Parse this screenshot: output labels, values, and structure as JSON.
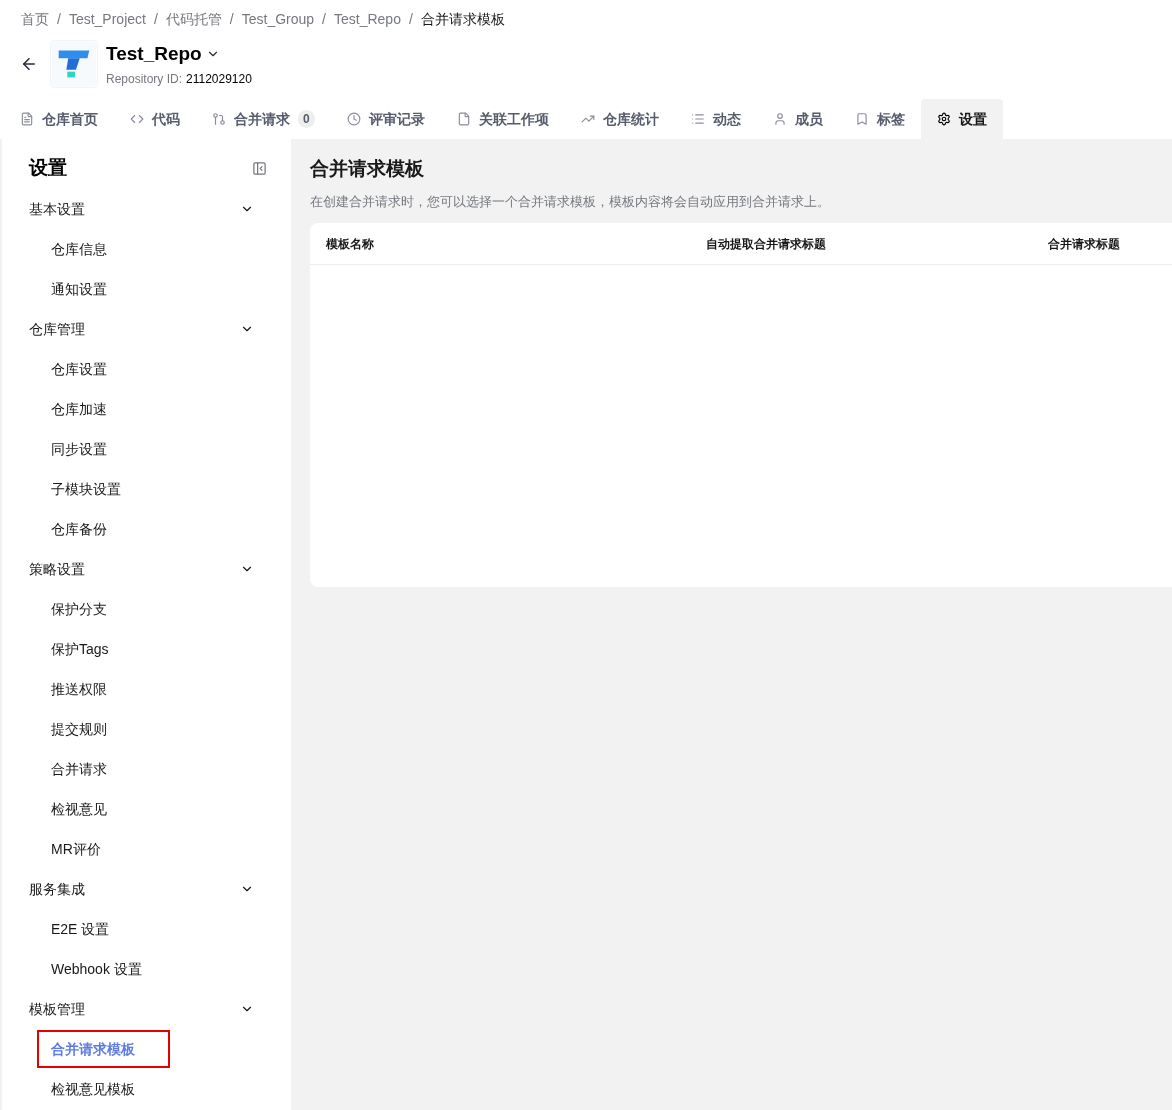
{
  "breadcrumb": [
    "首页",
    "Test_Project",
    "代码托管",
    "Test_Group",
    "Test_Repo",
    "合并请求模板"
  ],
  "breadcrumb_separator": "/",
  "repo": {
    "name": "Test_Repo",
    "id_label": "Repository ID:",
    "id": "2112029120"
  },
  "tabs": [
    {
      "label": "仓库首页",
      "selected": false
    },
    {
      "label": "代码",
      "selected": false
    },
    {
      "label": "合并请求",
      "count": "0",
      "selected": false
    },
    {
      "label": "评审记录",
      "selected": false
    },
    {
      "label": "关联工作项",
      "selected": false
    },
    {
      "label": "仓库统计",
      "selected": false
    },
    {
      "label": "动态",
      "selected": false
    },
    {
      "label": "成员",
      "selected": false
    },
    {
      "label": "标签",
      "selected": false
    },
    {
      "label": "设置",
      "selected": true
    }
  ],
  "sidebar": {
    "title": "设置",
    "groups": [
      {
        "label": "基本设置",
        "expanded": true,
        "children": [
          {
            "label": "仓库信息",
            "selected": false,
            "annotated": false
          },
          {
            "label": "通知设置",
            "selected": false,
            "annotated": false
          }
        ]
      },
      {
        "label": "仓库管理",
        "expanded": true,
        "children": [
          {
            "label": "仓库设置",
            "selected": false,
            "annotated": false
          },
          {
            "label": "仓库加速",
            "selected": false,
            "annotated": false
          },
          {
            "label": "同步设置",
            "selected": false,
            "annotated": false
          },
          {
            "label": "子模块设置",
            "selected": false,
            "annotated": false
          },
          {
            "label": "仓库备份",
            "selected": false,
            "annotated": false
          }
        ]
      },
      {
        "label": "策略设置",
        "expanded": true,
        "children": [
          {
            "label": "保护分支",
            "selected": false,
            "annotated": false
          },
          {
            "label": "保护Tags",
            "selected": false,
            "annotated": false
          },
          {
            "label": "推送权限",
            "selected": false,
            "annotated": false
          },
          {
            "label": "提交规则",
            "selected": false,
            "annotated": false
          },
          {
            "label": "合并请求",
            "selected": false,
            "annotated": false
          },
          {
            "label": "检视意见",
            "selected": false,
            "annotated": false
          },
          {
            "label": "MR评价",
            "selected": false,
            "annotated": false
          }
        ]
      },
      {
        "label": "服务集成",
        "expanded": true,
        "children": [
          {
            "label": "E2E 设置",
            "selected": false,
            "annotated": false
          },
          {
            "label": "Webhook 设置",
            "selected": false,
            "annotated": false
          }
        ]
      },
      {
        "label": "模板管理",
        "expanded": true,
        "children": [
          {
            "label": "合并请求模板",
            "selected": true,
            "annotated": true
          },
          {
            "label": "检视意见模板",
            "selected": false,
            "annotated": false
          }
        ]
      }
    ]
  },
  "content": {
    "title": "合并请求模板",
    "description": "在创建合并请求时，您可以选择一个合并请求模板，模板内容将会自动应用到合并请求上。",
    "table": {
      "columns": [
        "模板名称",
        "自动提取合并请求标题",
        "合并请求标题"
      ]
    }
  }
}
